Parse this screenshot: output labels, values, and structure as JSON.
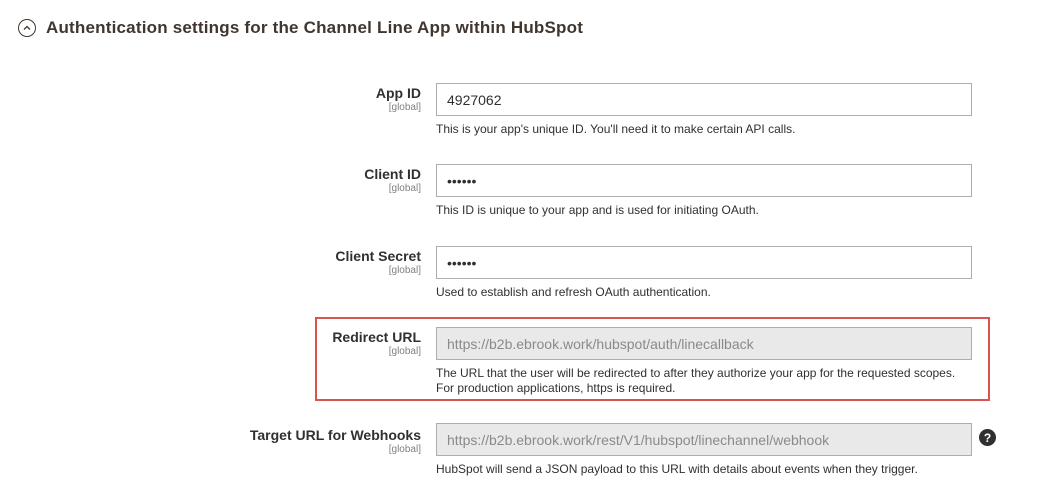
{
  "section": {
    "title": "Authentication settings for the Channel Line App within HubSpot"
  },
  "fields": [
    {
      "label": "App ID",
      "scope": "[global]",
      "value": "4927062",
      "note": "This is your app's unique ID. You'll need it to make certain API calls."
    },
    {
      "label": "Client ID",
      "scope": "[global]",
      "value": "••••••",
      "note": "This ID is unique to your app and is used for initiating OAuth."
    },
    {
      "label": "Client Secret",
      "scope": "[global]",
      "value": "••••••",
      "note": "Used to establish and refresh OAuth authentication."
    },
    {
      "label": "Redirect URL",
      "scope": "[global]",
      "value": "https://b2b.ebrook.work/hubspot/auth/linecallback",
      "note": "The URL that the user will be redirected to after they authorize your app for the requested scopes. For production applications, https is required."
    },
    {
      "label": "Target URL for Webhooks",
      "scope": "[global]",
      "value": "https://b2b.ebrook.work/rest/V1/hubspot/linechannel/webhook",
      "note": "HubSpot will send a JSON payload to this URL with details about events when they trigger."
    }
  ],
  "icons": {
    "collapse": "chevron-up-icon",
    "help": "help-icon",
    "help_glyph": "?"
  },
  "colors": {
    "highlight": "#d9534f",
    "title": "#41362f"
  }
}
